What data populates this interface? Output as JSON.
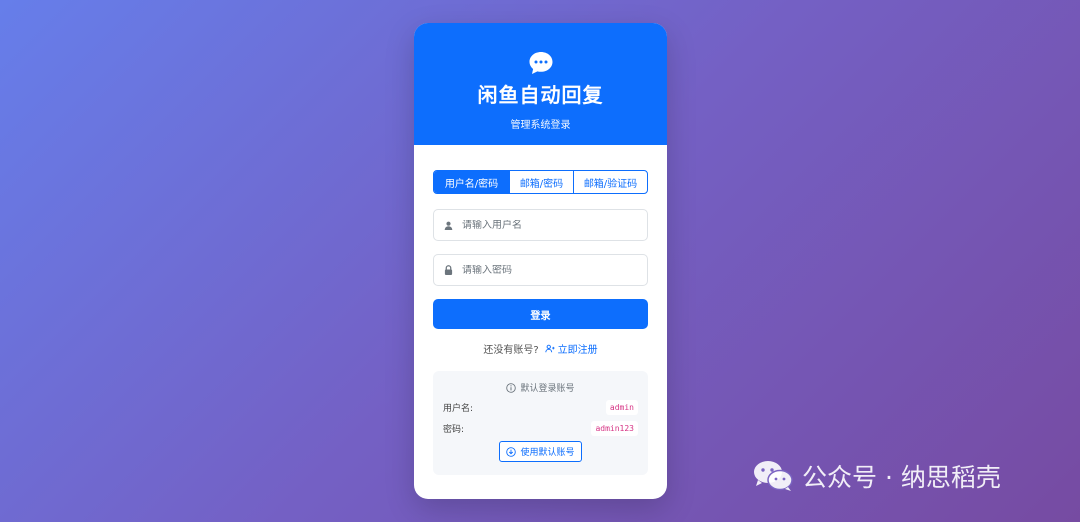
{
  "header": {
    "logo_icon": "chat-bubble-icon",
    "title": "闲鱼自动回复",
    "subtitle": "管理系统登录"
  },
  "tabs": [
    {
      "label": "用户名/密码",
      "active": true
    },
    {
      "label": "邮箱/密码",
      "active": false
    },
    {
      "label": "邮箱/验证码",
      "active": false
    }
  ],
  "form": {
    "username_placeholder": "请输入用户名",
    "password_placeholder": "请输入密码",
    "login_label": "登录"
  },
  "register": {
    "prompt": "还没有账号?",
    "link_label": "立即注册"
  },
  "defaults": {
    "title": "默认登录账号",
    "username_label": "用户名:",
    "username_value": "admin",
    "password_label": "密码:",
    "password_value": "admin123",
    "use_button_label": "使用默认账号"
  },
  "watermark": {
    "text": "公众号 · 纳思稻壳"
  },
  "colors": {
    "primary": "#0d6efd",
    "code": "#d63384",
    "bg_start": "#667eea",
    "bg_end": "#764ba2"
  }
}
